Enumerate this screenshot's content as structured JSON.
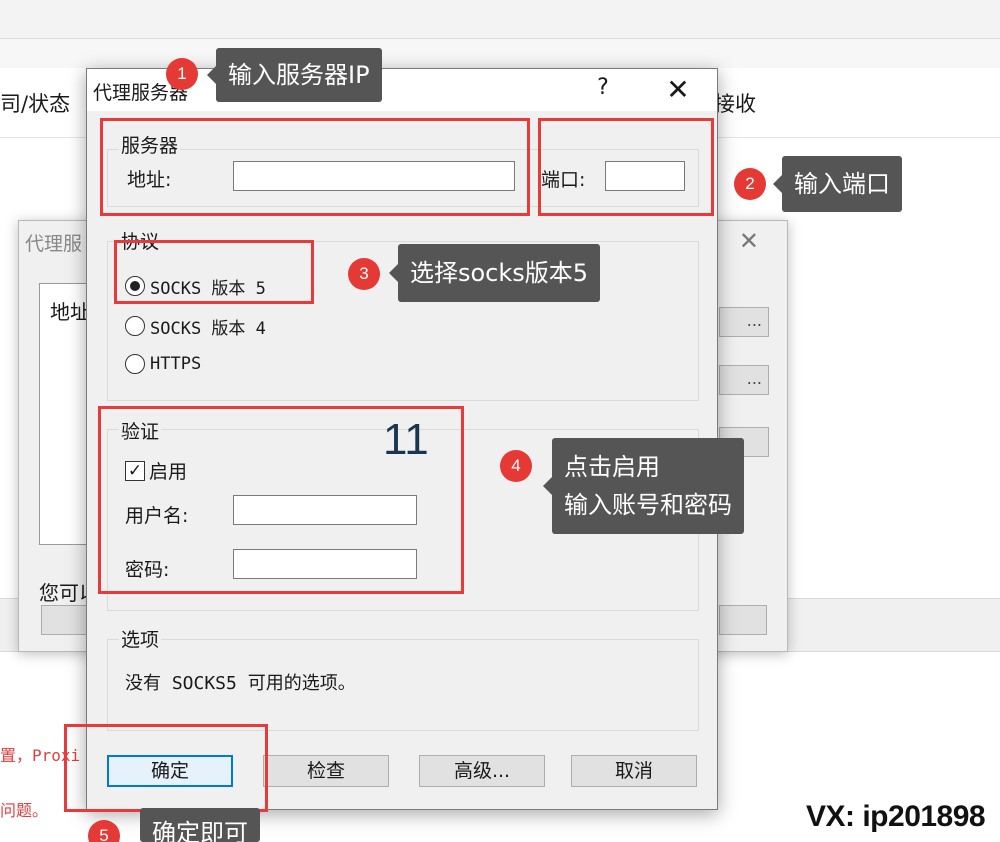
{
  "background": {
    "column_left": "司/状态",
    "column_right": "接收",
    "red_line_1": "置，Proxi",
    "red_line_2": "问题。"
  },
  "back_window": {
    "title": "代理服",
    "close_glyph": "✕",
    "list_header": "地址",
    "note": "您可以",
    "button_label": "..."
  },
  "dialog": {
    "title": "代理服务器",
    "help_glyph": "?",
    "close_glyph": "✕",
    "server_group": "服务器",
    "address_label": "地址:",
    "address_value": "",
    "port_label": "端口:",
    "port_value": "",
    "protocol_group": "协议",
    "protocols": [
      {
        "label": "SOCKS 版本 5",
        "selected": true
      },
      {
        "label": "SOCKS 版本 4",
        "selected": false
      },
      {
        "label": "HTTPS",
        "selected": false
      }
    ],
    "auth_group": "验证",
    "enable_label": "启用",
    "enable_checked": true,
    "username_label": "用户名:",
    "username_value": "",
    "password_label": "密码:",
    "password_value": "",
    "overlay_number": "11",
    "options_group": "选项",
    "options_text": "没有 SOCKS5 可用的选项。",
    "buttons": {
      "ok": "确定",
      "check": "检查",
      "advanced": "高级...",
      "cancel": "取消"
    }
  },
  "annotations": [
    {
      "number": "1",
      "text": "输入服务器IP"
    },
    {
      "number": "2",
      "text": "输入端口"
    },
    {
      "number": "3",
      "text": "选择socks版本5"
    },
    {
      "number": "4",
      "text_line1": "点击启用",
      "text_line2": "输入账号和密码"
    },
    {
      "number": "5",
      "text": "确定即可"
    }
  ],
  "watermark": "VX: ip201898",
  "colors": {
    "annotation_red": "#e53935",
    "tooltip_bg": "#555555",
    "default_button_border": "#0078d7"
  }
}
